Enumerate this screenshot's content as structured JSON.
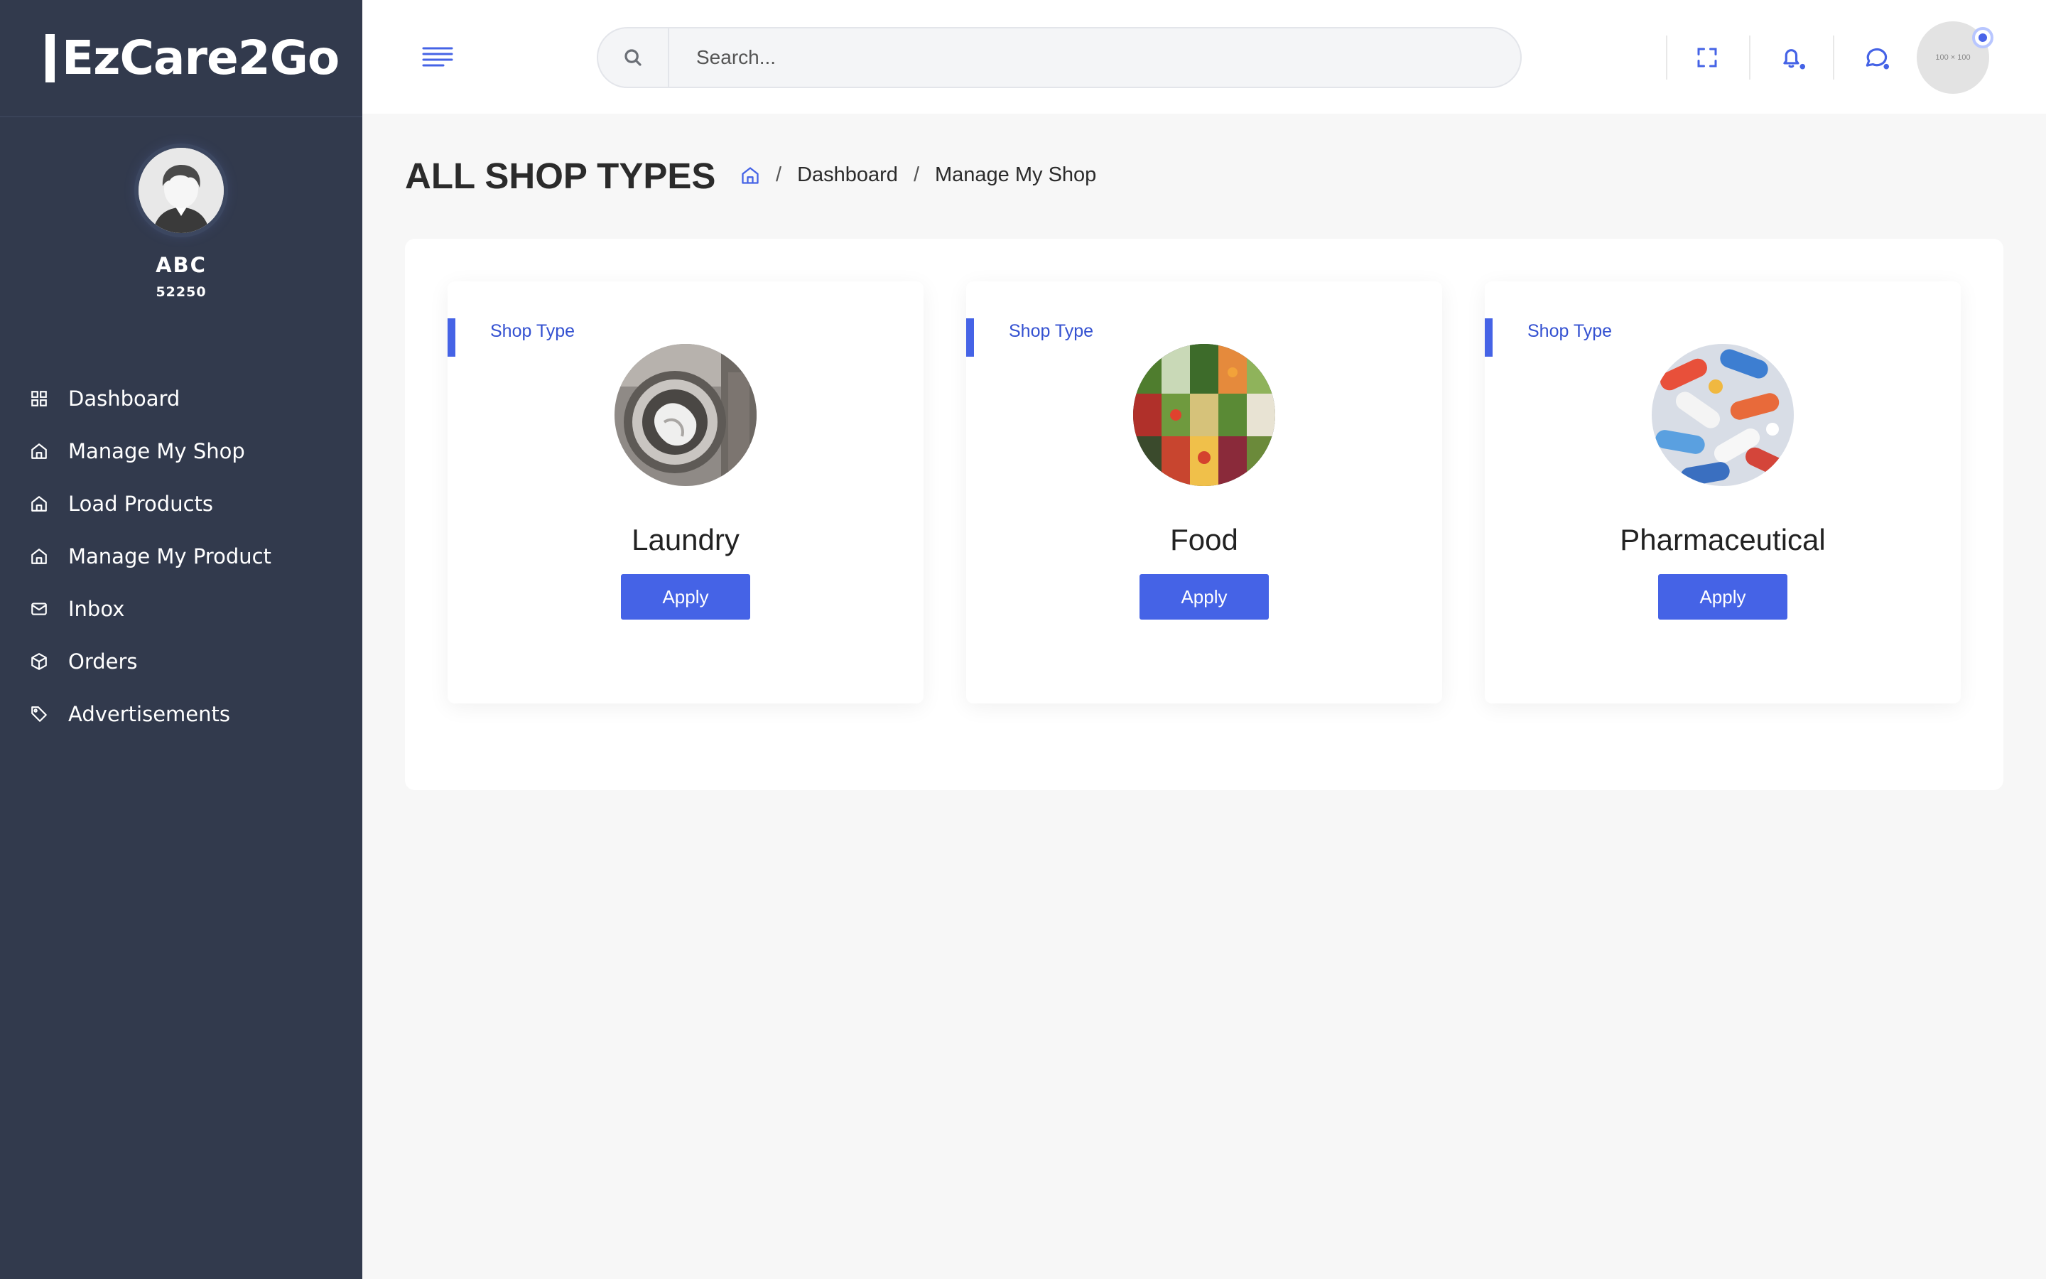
{
  "app": {
    "brand": "EzCare2Go"
  },
  "user": {
    "name": "ABC",
    "id": "52250",
    "avatar_icon": "user-avatar-icon"
  },
  "sidebar": {
    "items": [
      {
        "label": "Dashboard",
        "icon": "grid-icon"
      },
      {
        "label": "Manage My Shop",
        "icon": "home-icon"
      },
      {
        "label": "Load Products",
        "icon": "home-icon"
      },
      {
        "label": "Manage My Product",
        "icon": "home-icon"
      },
      {
        "label": "Inbox",
        "icon": "mail-icon"
      },
      {
        "label": "Orders",
        "icon": "box-icon"
      },
      {
        "label": "Advertisements",
        "icon": "tag-icon"
      }
    ]
  },
  "header": {
    "search_placeholder": "Search...",
    "avatar_placeholder": "100 × 100",
    "icons": [
      "menu-icon",
      "search-icon",
      "fullscreen-icon",
      "bell-icon",
      "chat-icon"
    ]
  },
  "page": {
    "title": "ALL SHOP TYPES",
    "breadcrumb": [
      "Dashboard",
      "Manage My Shop"
    ]
  },
  "shop_types": [
    {
      "label": "Shop Type",
      "name": "Laundry",
      "button": "Apply",
      "image": "washing-machine"
    },
    {
      "label": "Shop Type",
      "name": "Food",
      "button": "Apply",
      "image": "vegetables"
    },
    {
      "label": "Shop Type",
      "name": "Pharmaceutical",
      "button": "Apply",
      "image": "pills"
    }
  ],
  "colors": {
    "sidebar_bg": "#323a4d",
    "accent": "#4563e6",
    "page_bg": "#f7f7f7"
  }
}
